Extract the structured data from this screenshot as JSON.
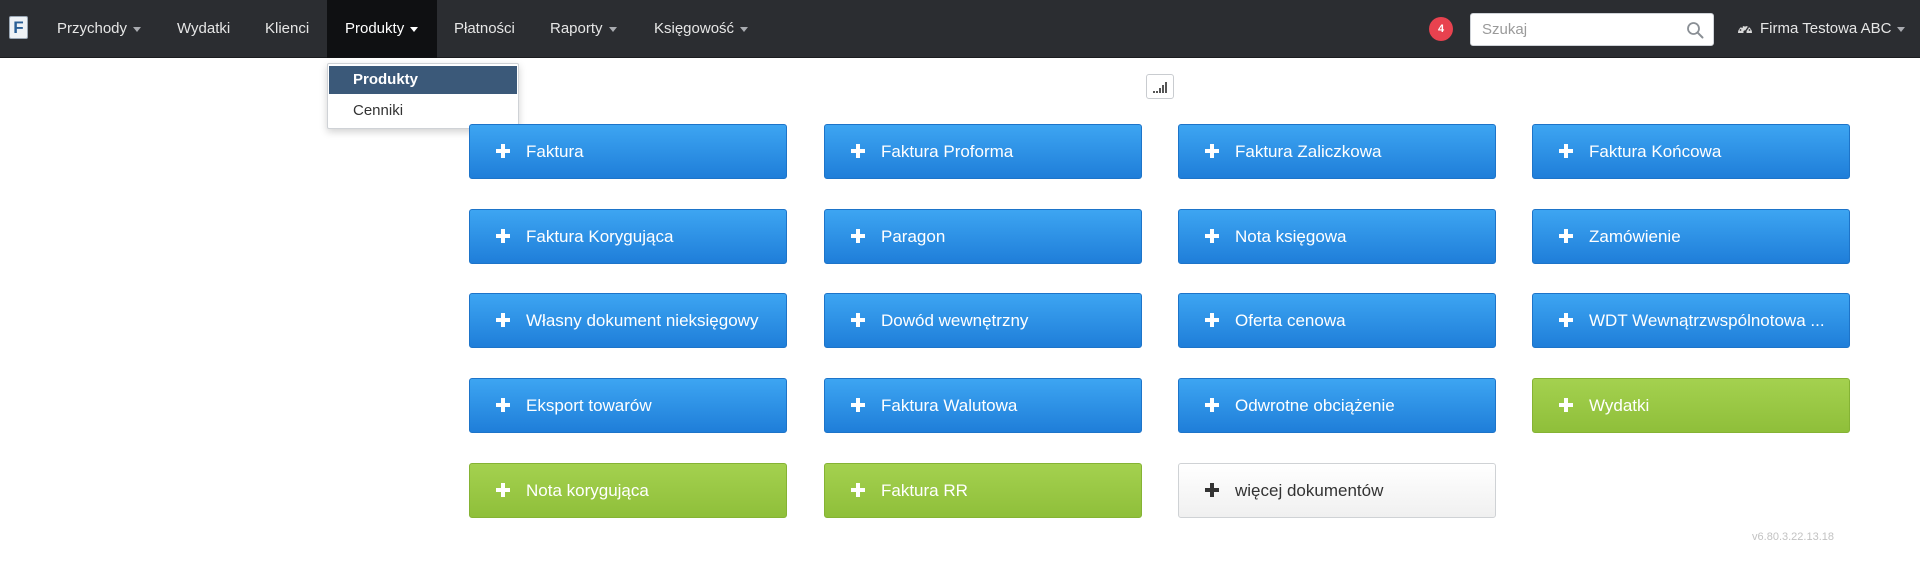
{
  "navbar": {
    "logo_letter": "F",
    "items": [
      {
        "label": "Przychody",
        "has_caret": true
      },
      {
        "label": "Wydatki",
        "has_caret": false
      },
      {
        "label": "Klienci",
        "has_caret": false
      },
      {
        "label": "Produkty",
        "has_caret": true,
        "active": true
      },
      {
        "label": "Płatności",
        "has_caret": false
      },
      {
        "label": "Raporty",
        "has_caret": true
      },
      {
        "label": "Księgowość",
        "has_caret": true
      }
    ],
    "notification_count": "4",
    "search_placeholder": "Szukaj",
    "search_icon": "search-icon",
    "user_icon": "dashboard-gauge-icon",
    "company_name": "Firma Testowa ABC"
  },
  "dropdown": {
    "items": [
      {
        "label": "Produkty",
        "selected": true
      },
      {
        "label": "Cenniki",
        "selected": false
      }
    ]
  },
  "chart_toggle_icon": "signal-bars-icon",
  "documents": [
    {
      "label": "Faktura",
      "style": "blue"
    },
    {
      "label": "Faktura Proforma",
      "style": "blue"
    },
    {
      "label": "Faktura Zaliczkowa",
      "style": "blue"
    },
    {
      "label": "Faktura Końcowa",
      "style": "blue"
    },
    {
      "label": "Faktura Korygująca",
      "style": "blue"
    },
    {
      "label": "Paragon",
      "style": "blue"
    },
    {
      "label": "Nota księgowa",
      "style": "blue"
    },
    {
      "label": "Zamówienie",
      "style": "blue"
    },
    {
      "label": "Własny dokument nieksięgowy",
      "style": "blue"
    },
    {
      "label": "Dowód wewnętrzny",
      "style": "blue"
    },
    {
      "label": "Oferta cenowa",
      "style": "blue"
    },
    {
      "label": "WDT Wewnątrzwspólnotowa ...",
      "style": "blue"
    },
    {
      "label": "Eksport towarów",
      "style": "blue"
    },
    {
      "label": "Faktura Walutowa",
      "style": "blue"
    },
    {
      "label": "Odwrotne obciążenie",
      "style": "blue"
    },
    {
      "label": "Wydatki",
      "style": "green"
    },
    {
      "label": "Nota korygująca",
      "style": "green"
    },
    {
      "label": "Faktura RR",
      "style": "green"
    },
    {
      "label": "więcej dokumentów",
      "style": "white"
    }
  ],
  "colors": {
    "navbar_bg": "#2b2d31",
    "active_tab_bg": "#0f1012",
    "button_blue": "#1f7ed9",
    "button_green": "#8fbf3a",
    "badge_red": "#e8424f",
    "dropdown_selected": "#3b5979"
  },
  "version": "v6.80.3.22.13.18"
}
